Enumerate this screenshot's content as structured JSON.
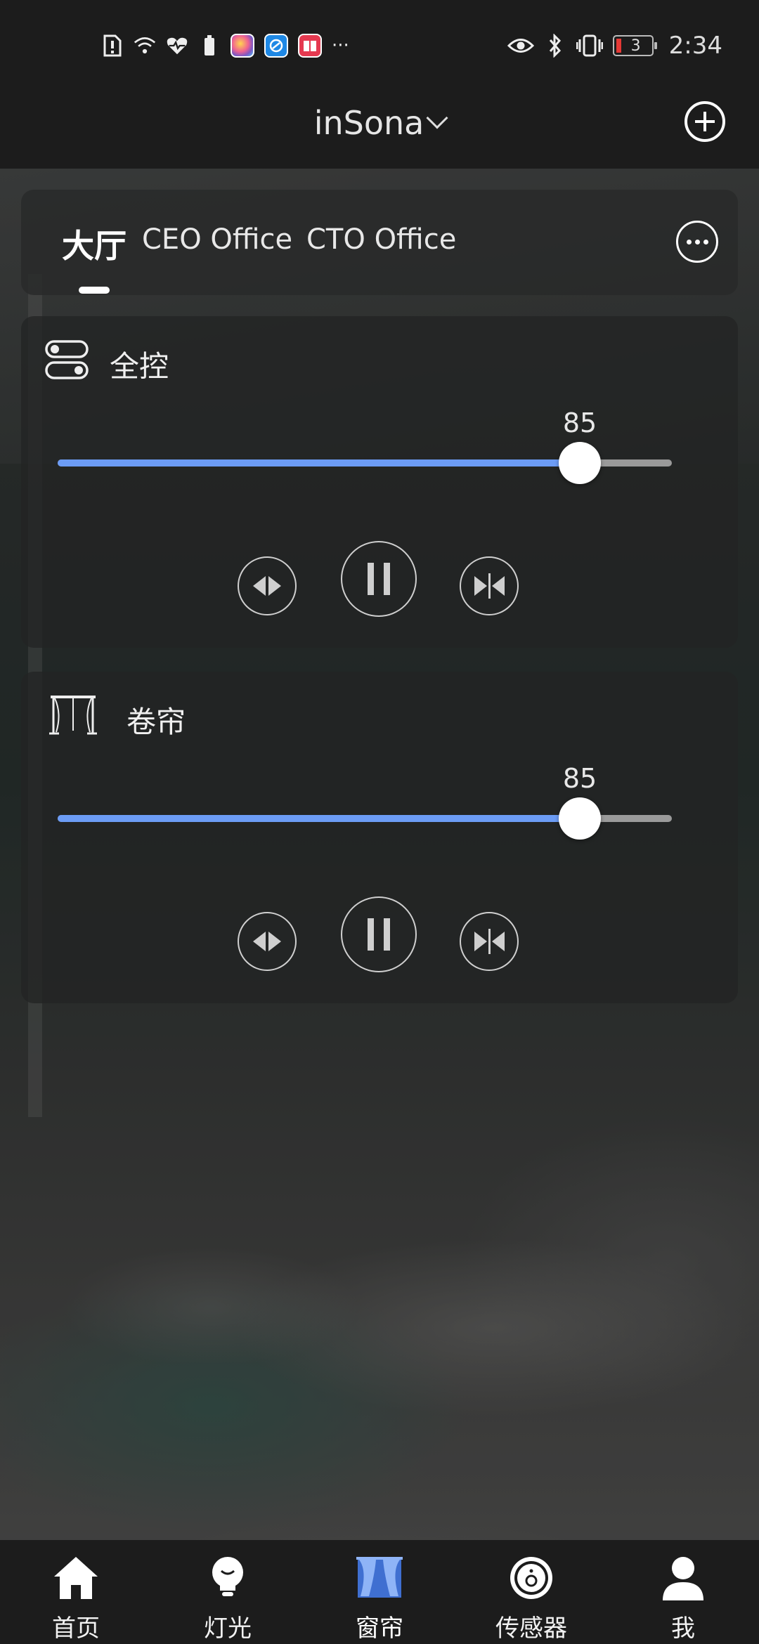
{
  "status_bar": {
    "time": "2:34",
    "battery_level": "3",
    "left_icons": [
      "alert-icon",
      "wifi-icon",
      "health-icon",
      "battery-saver-icon",
      "app-photos-icon",
      "app-browser-icon",
      "app-books-icon",
      "more-dots-icon"
    ],
    "right_icons": [
      "eye-icon",
      "bluetooth-icon",
      "vibrate-icon",
      "battery-icon"
    ],
    "overflow": "···"
  },
  "header": {
    "title": "inSona"
  },
  "rooms": {
    "tabs": [
      {
        "label": "大厅",
        "active": true
      },
      {
        "label": "CEO Office",
        "active": false
      },
      {
        "label": "CTO Office",
        "active": false
      }
    ]
  },
  "cards": [
    {
      "title": "全控",
      "icon": "toggle-icon",
      "value": "85",
      "level": 0.85
    },
    {
      "title": "卷帘",
      "icon": "roller-blind-icon",
      "value": "85",
      "level": 0.85
    }
  ],
  "nav": {
    "items": [
      {
        "label": "首页",
        "icon": "home-icon",
        "active": false
      },
      {
        "label": "灯光",
        "icon": "bulb-icon",
        "active": false
      },
      {
        "label": "窗帘",
        "icon": "curtain-icon",
        "active": true
      },
      {
        "label": "传感器",
        "icon": "sensor-icon",
        "active": false
      },
      {
        "label": "我",
        "icon": "user-icon",
        "active": false
      }
    ]
  },
  "colors": {
    "accent": "#6c9cf5",
    "bar_bg": "#1c1c1c",
    "card_bg": "#222424"
  }
}
